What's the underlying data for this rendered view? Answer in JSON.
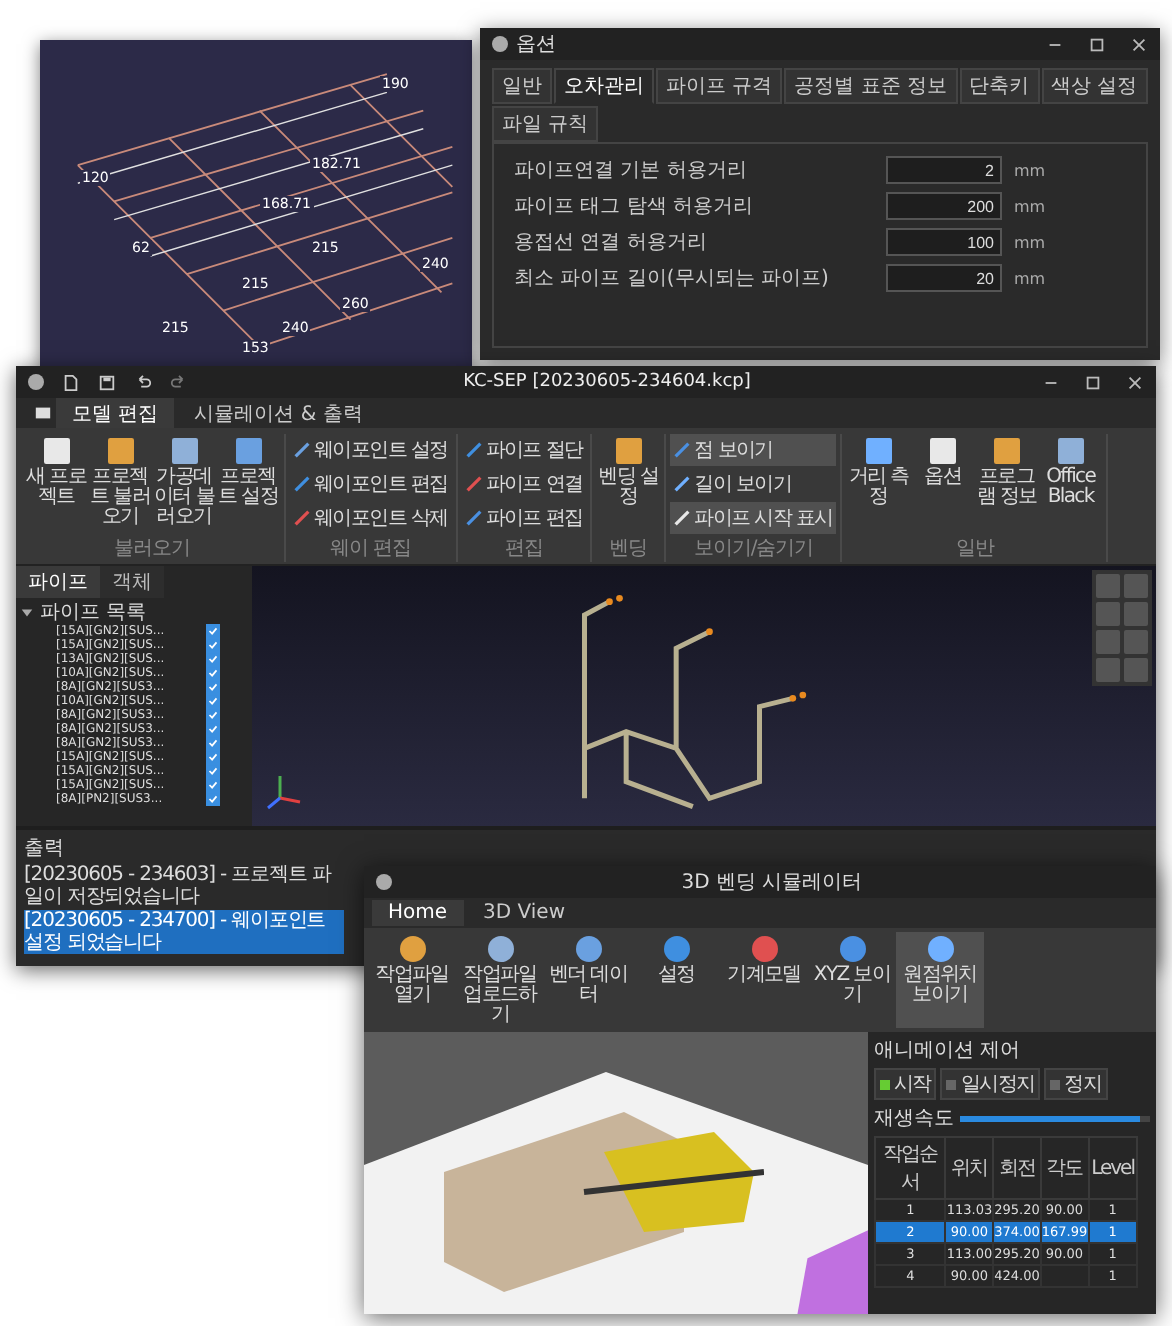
{
  "wireframe_view": {
    "labels": [
      "190",
      "182.71",
      "168.71",
      "215",
      "240",
      "260",
      "215",
      "240",
      "215",
      "153",
      "120",
      "62"
    ]
  },
  "options_dialog": {
    "title": "옵션",
    "tabs": [
      {
        "label": "일반",
        "selected": false
      },
      {
        "label": "오차관리",
        "selected": true
      },
      {
        "label": "파이프 규격",
        "selected": false
      },
      {
        "label": "공정별 표준 정보",
        "selected": false
      },
      {
        "label": "단축키",
        "selected": false
      },
      {
        "label": "색상 설정",
        "selected": false
      },
      {
        "label": "파일 규칙",
        "selected": false
      }
    ],
    "fields": [
      {
        "label": "파이프연결 기본 허용거리",
        "value": "2",
        "unit": "mm"
      },
      {
        "label": "파이프 태그 탐색 허용거리",
        "value": "200",
        "unit": "mm"
      },
      {
        "label": "용접선 연결 허용거리",
        "value": "100",
        "unit": "mm"
      },
      {
        "label": "최소 파이프 길이(무시되는 파이프)",
        "value": "20",
        "unit": "mm"
      }
    ]
  },
  "main_window": {
    "title": "KC-SEP [20230605-234604.kcp]",
    "menu_tabs": [
      {
        "label": "모델 편집",
        "selected": true
      },
      {
        "label": "시뮬레이션 & 출력",
        "selected": false
      }
    ],
    "ribbon_groups": [
      {
        "label": "불러오기",
        "kind": "large",
        "items": [
          {
            "label": "새 프로젝트",
            "selected": false
          },
          {
            "label": "프로젝트 불러오기",
            "selected": false
          },
          {
            "label": "가공데이터 불러오기",
            "selected": false
          },
          {
            "label": "프로젝트 설정",
            "selected": false
          }
        ]
      },
      {
        "label": "웨이 편집",
        "kind": "small",
        "items": [
          {
            "label": "웨이포인트 설정",
            "selected": false
          },
          {
            "label": "웨이포인트 편집",
            "selected": false
          },
          {
            "label": "웨이포인트 삭제",
            "selected": false
          }
        ]
      },
      {
        "label": "편집",
        "kind": "small",
        "items": [
          {
            "label": "파이프 절단",
            "selected": false
          },
          {
            "label": "파이프 연결",
            "selected": false
          },
          {
            "label": "파이프 편집",
            "selected": false
          }
        ]
      },
      {
        "label": "벤딩",
        "kind": "large",
        "items": [
          {
            "label": "벤딩 설정",
            "selected": false
          }
        ]
      },
      {
        "label": "보이기/숨기기",
        "kind": "small",
        "items": [
          {
            "label": "점 보이기",
            "selected": true
          },
          {
            "label": "길이 보이기",
            "selected": false
          },
          {
            "label": "파이프 시작 표시",
            "selected": true
          }
        ]
      },
      {
        "label": "일반",
        "kind": "large",
        "items": [
          {
            "label": "거리 측정",
            "selected": false
          },
          {
            "label": "옵션",
            "selected": false
          },
          {
            "label": "프로그램 정보",
            "selected": false
          },
          {
            "label": "Office Black",
            "selected": false
          }
        ]
      }
    ],
    "panel_tabs": [
      {
        "label": "파이프",
        "selected": true
      },
      {
        "label": "객체",
        "selected": false
      }
    ],
    "tree": {
      "label": "파이프 목록",
      "expanded": true,
      "children": [
        {
          "label": "[15A][GN2][SUS...",
          "checked": true
        },
        {
          "label": "[15A][GN2][SUS...",
          "checked": true
        },
        {
          "label": "[13A][GN2][SUS...",
          "checked": true
        },
        {
          "label": "[10A][GN2][SUS...",
          "checked": true
        },
        {
          "label": "[8A][GN2][SUS3...",
          "checked": true
        },
        {
          "label": "[10A][GN2][SUS...",
          "checked": true
        },
        {
          "label": "[8A][GN2][SUS3...",
          "checked": true
        },
        {
          "label": "[8A][GN2][SUS3...",
          "checked": true
        },
        {
          "label": "[8A][GN2][SUS3...",
          "checked": true
        },
        {
          "label": "[15A][GN2][SUS...",
          "checked": true
        },
        {
          "label": "[15A][GN2][SUS...",
          "checked": true
        },
        {
          "label": "[15A][GN2][SUS...",
          "checked": true
        },
        {
          "label": "[8A][PN2][SUS3...",
          "checked": true
        }
      ]
    },
    "output": {
      "title": "출력",
      "lines": [
        {
          "text": "[20230605 - 234603] - 프로젝트 파일이 저장되었습니다",
          "selected": false
        },
        {
          "text": "[20230605 - 234700] - 웨이포인트 설정 되었습니다",
          "selected": true
        }
      ]
    }
  },
  "simulator": {
    "title": "3D 벤딩 시뮬레이터",
    "tabs": [
      {
        "label": "Home",
        "selected": true
      },
      {
        "label": "3D View",
        "selected": false
      }
    ],
    "toolbar": [
      {
        "label": "작업파일 열기",
        "selected": false
      },
      {
        "label": "작업파일 업로드하기",
        "selected": false
      },
      {
        "label": "벤더 데이터",
        "selected": false
      },
      {
        "label": "설정",
        "selected": false
      },
      {
        "label": "기계모델",
        "selected": false
      },
      {
        "label": "XYZ 보이기",
        "selected": false
      },
      {
        "label": "원점위치 보이기",
        "selected": true
      }
    ],
    "animation_panel": {
      "title": "애니메이션 제어",
      "controls": [
        {
          "label": "시작",
          "on": true
        },
        {
          "label": "일시정지",
          "on": false
        },
        {
          "label": "정지",
          "on": false
        }
      ],
      "speed": {
        "label": "재생속도",
        "level": 0.95
      },
      "columns": [
        "작업순서",
        "위치",
        "회전",
        "각도",
        "Level"
      ],
      "rows": [
        {
          "cells": [
            "1",
            "113.03",
            "295.20",
            "90.00",
            "1"
          ],
          "selected": false
        },
        {
          "cells": [
            "2",
            "90.00",
            "374.00",
            "167.99",
            "1"
          ],
          "selected": true
        },
        {
          "cells": [
            "3",
            "113.00",
            "295.20",
            "90.00",
            "1"
          ],
          "selected": false
        },
        {
          "cells": [
            "4",
            "90.00",
            "424.00",
            null,
            "1"
          ],
          "selected": false
        }
      ]
    }
  }
}
